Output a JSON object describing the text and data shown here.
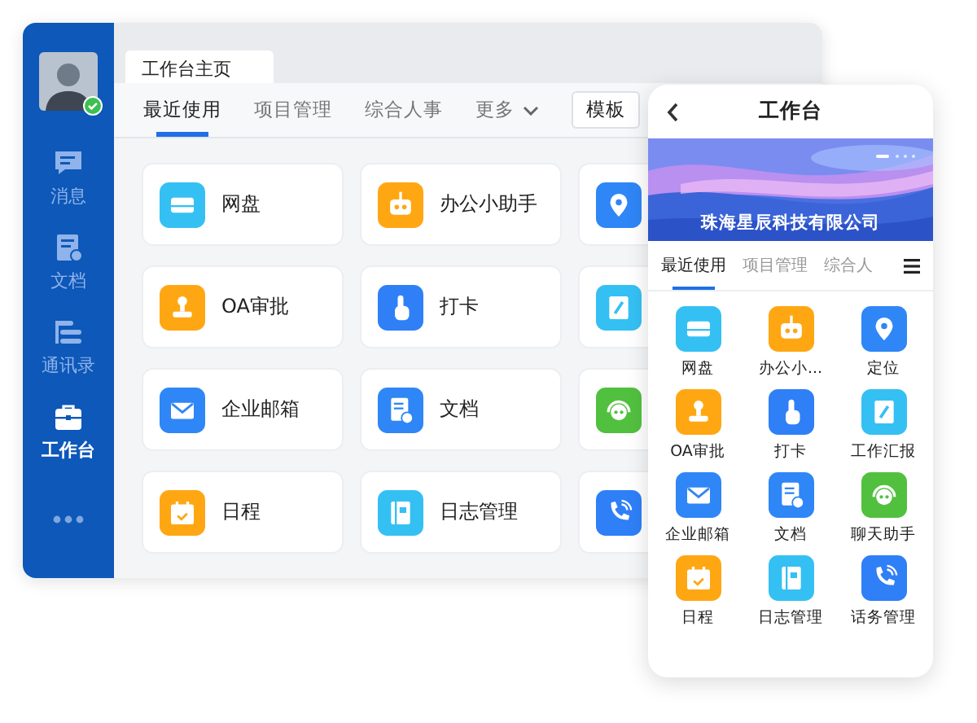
{
  "sidebar": {
    "avatar": {
      "online": true
    },
    "items": [
      {
        "label": "消息",
        "selected": false
      },
      {
        "label": "文档",
        "selected": false
      },
      {
        "label": "通讯录",
        "selected": false
      },
      {
        "label": "工作台",
        "selected": true
      }
    ]
  },
  "window": {
    "tab": "工作台主页"
  },
  "nav": {
    "tabs": [
      {
        "label": "最近使用",
        "selected": true
      },
      {
        "label": "项目管理",
        "selected": false
      },
      {
        "label": "综合人事",
        "selected": false
      }
    ],
    "more": "更多",
    "template_button": "模板"
  },
  "apps": [
    {
      "kind": "drive",
      "label": "网盘"
    },
    {
      "kind": "robot",
      "label": "办公小助手"
    },
    {
      "kind": "location"
    },
    {
      "kind": "stamp",
      "label": "OA审批"
    },
    {
      "kind": "tap",
      "label": "打卡"
    },
    {
      "kind": "report"
    },
    {
      "kind": "mail",
      "label": "企业邮箱"
    },
    {
      "kind": "doc",
      "label": "文档"
    },
    {
      "kind": "chat"
    },
    {
      "kind": "calendar",
      "label": "日程"
    },
    {
      "kind": "notebook",
      "label": "日志管理"
    },
    {
      "kind": "phone"
    }
  ],
  "phone": {
    "title": "工作台",
    "banner": {
      "company": "珠海星辰科技有限公司"
    },
    "tabs": [
      {
        "label": "最近使用",
        "selected": true
      },
      {
        "label": "项目管理",
        "selected": false
      },
      {
        "label": "综合人",
        "selected": false
      }
    ],
    "apps": [
      {
        "kind": "drive",
        "label": "网盘"
      },
      {
        "kind": "robot",
        "label": "办公小..."
      },
      {
        "kind": "location",
        "label": "定位"
      },
      {
        "kind": "stamp",
        "label": "OA审批"
      },
      {
        "kind": "tap",
        "label": "打卡"
      },
      {
        "kind": "report",
        "label": "工作汇报"
      },
      {
        "kind": "mail",
        "label": "企业邮箱"
      },
      {
        "kind": "doc",
        "label": "文档"
      },
      {
        "kind": "chat",
        "label": "聊天助手"
      },
      {
        "kind": "calendar",
        "label": "日程"
      },
      {
        "kind": "notebook",
        "label": "日志管理"
      },
      {
        "kind": "phone",
        "label": "话务管理"
      }
    ]
  }
}
